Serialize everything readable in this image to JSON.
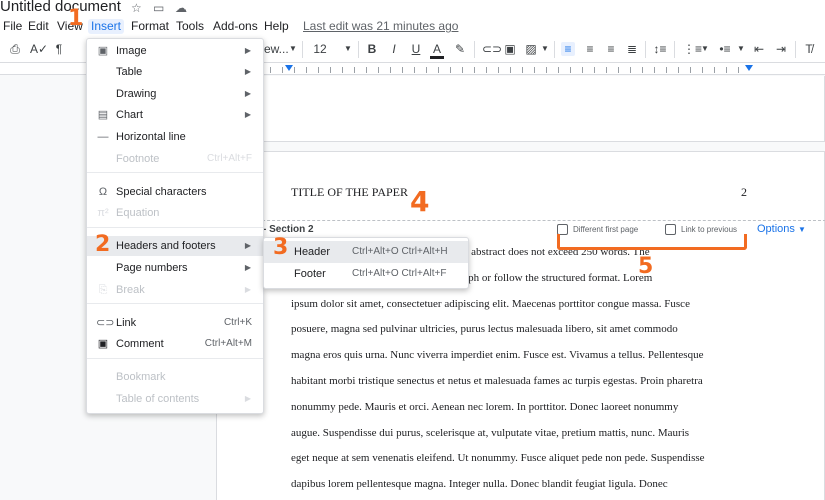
{
  "titlebar": {
    "title": "Untitled document",
    "icons": [
      "star-icon",
      "folder-icon",
      "cloud-icon"
    ]
  },
  "menubar": {
    "items": [
      "File",
      "Edit",
      "View",
      "Insert",
      "Format",
      "Tools",
      "Add-ons",
      "Help"
    ],
    "active": "Insert",
    "last_edit": "Last edit was 21 minutes ago"
  },
  "toolbar": {
    "font_name": "ew...",
    "font_size": "12",
    "bold": "B",
    "italic": "I",
    "underline": "U",
    "text_color": "A"
  },
  "insert_menu": {
    "items": [
      {
        "label": "Image",
        "icon": "image-icon",
        "submenu": true,
        "disabled": false
      },
      {
        "label": "Table",
        "icon": "",
        "submenu": true,
        "disabled": false
      },
      {
        "label": "Drawing",
        "icon": "",
        "submenu": true,
        "disabled": false
      },
      {
        "label": "Chart",
        "icon": "chart-icon",
        "submenu": true,
        "disabled": false
      },
      {
        "label": "Horizontal line",
        "icon": "horizontal-line-icon",
        "submenu": false,
        "disabled": false
      },
      {
        "label": "Footnote",
        "icon": "",
        "shortcut": "Ctrl+Alt+F",
        "disabled": true
      },
      {
        "label": "Special characters",
        "icon": "omega-icon",
        "submenu": false,
        "disabled": false
      },
      {
        "label": "Equation",
        "icon": "pi-icon",
        "submenu": false,
        "disabled": true
      },
      {
        "label": "Headers and footers",
        "icon": "",
        "submenu": true,
        "disabled": false,
        "highlighted": true
      },
      {
        "label": "Page numbers",
        "icon": "",
        "submenu": true,
        "disabled": false
      },
      {
        "label": "Break",
        "icon": "break-icon",
        "submenu": true,
        "disabled": true
      },
      {
        "label": "Link",
        "icon": "link-icon",
        "shortcut": "Ctrl+K",
        "disabled": false
      },
      {
        "label": "Comment",
        "icon": "comment-icon",
        "shortcut": "Ctrl+Alt+M",
        "disabled": false
      },
      {
        "label": "Bookmark",
        "icon": "",
        "disabled": true
      },
      {
        "label": "Table of contents",
        "icon": "",
        "submenu": true,
        "disabled": true
      }
    ]
  },
  "submenu": {
    "items": [
      {
        "label": "Header",
        "shortcut": "Ctrl+Alt+O Ctrl+Alt+H",
        "highlighted": true
      },
      {
        "label": "Footer",
        "shortcut": "Ctrl+Alt+O Ctrl+Alt+F",
        "highlighted": false
      }
    ]
  },
  "document": {
    "header_title": "TITLE OF THE PAPER",
    "page_number": "2",
    "section_label": "- Section 2",
    "different_first_page": "Different first page",
    "link_to_previous": "Link to previous",
    "options": "Options",
    "body_lines": [
      "Mostly, the abstract does not exceed 250 words. The",
      "gle paragraph or follow the structured format. Lorem",
      "ipsum dolor sit amet, consectetuer adipiscing elit. Maecenas porttitor congue massa. Fusce",
      "posuere, magna sed pulvinar ultricies, purus lectus malesuada libero, sit amet commodo",
      "magna eros quis urna. Nunc viverra imperdiet enim. Fusce est. Vivamus a tellus. Pellentesque",
      "habitant morbi tristique senectus et netus et malesuada fames ac turpis egestas. Proin pharetra",
      "nonummy pede. Mauris et orci. Aenean nec lorem. In porttitor. Donec laoreet nonummy",
      "augue. Suspendisse dui purus, scelerisque at, vulputate vitae, pretium mattis, nunc. Mauris",
      "eget neque at sem venenatis eleifend. Ut nonummy. Fusce aliquet pede non pede. Suspendisse",
      "dapibus lorem pellentesque magna. Integer nulla. Donec blandit feugiat ligula. Donec"
    ]
  },
  "annotations": [
    "1",
    "2",
    "3",
    "4",
    "5"
  ],
  "colors": {
    "accent": "#1a73e8",
    "annotation": "#f26b21",
    "highlight": "#e8eaed"
  }
}
